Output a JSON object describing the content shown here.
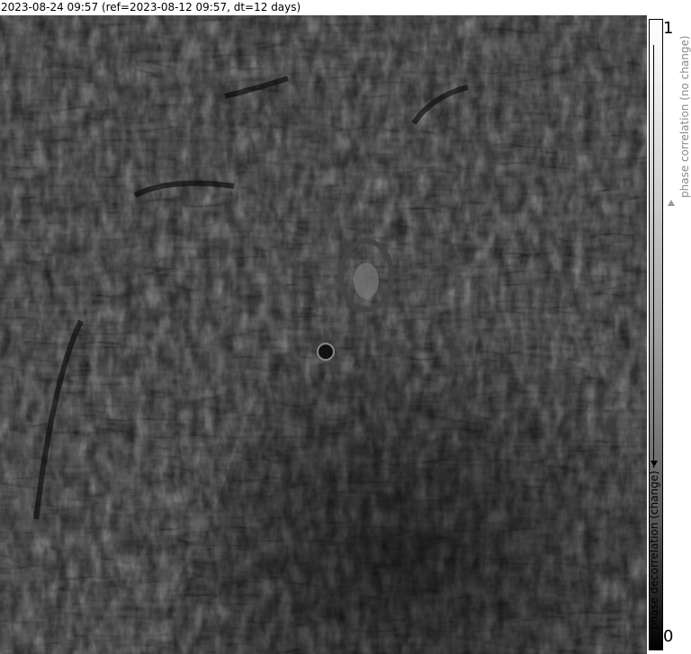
{
  "header": {
    "title": "2023-08-24 09:57 (ref=2023-08-12 09:57, dt=12 days)"
  },
  "colorbar": {
    "max_label": "1",
    "min_label": "0",
    "top_caption": "phase correlation (no change)",
    "bottom_caption": "phase decorrelation (change)",
    "colormap": "grayscale"
  },
  "colors": {
    "background": "#1a1a1a",
    "high": "#ffffff",
    "low": "#000000"
  },
  "map": {
    "type": "InSAR coherence image"
  }
}
